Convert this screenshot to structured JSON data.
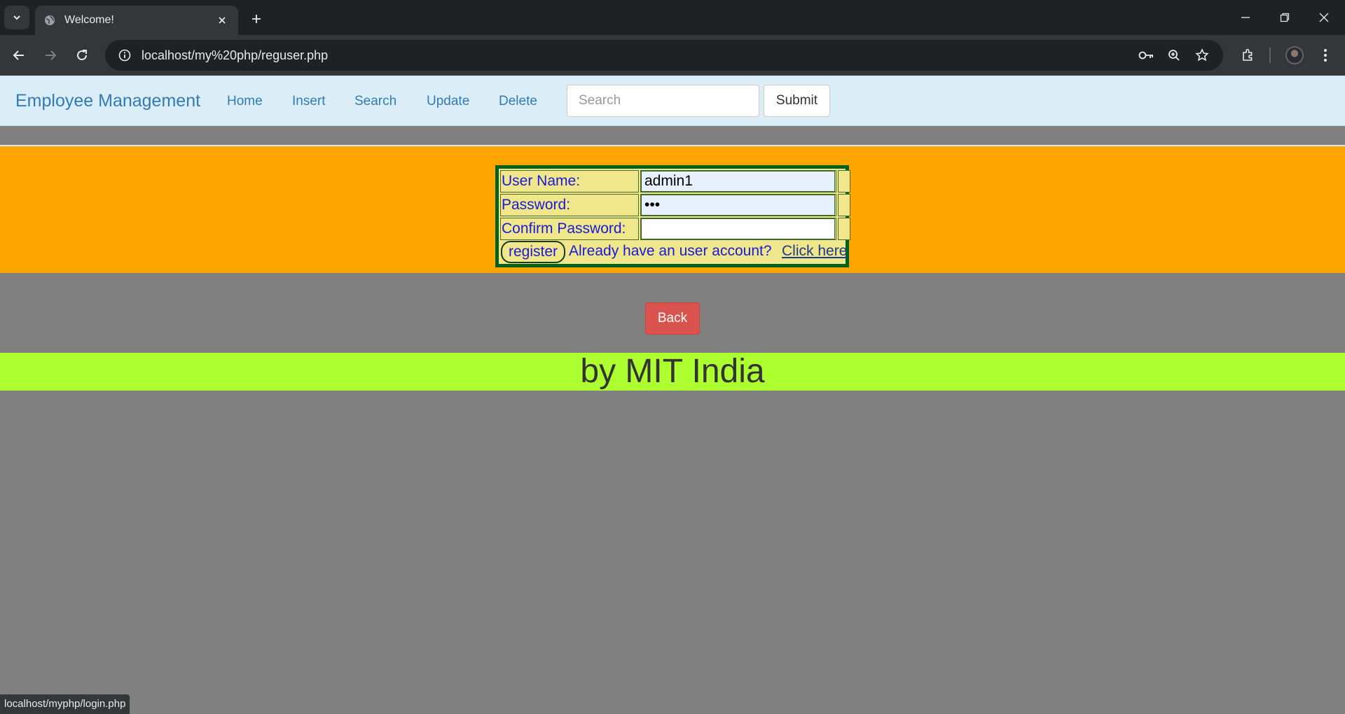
{
  "browser": {
    "tab_title": "Welcome!",
    "url": "localhost/my%20php/reguser.php",
    "status_url": "localhost/myphp/login.php"
  },
  "navbar": {
    "brand": "Employee Management",
    "links": [
      "Home",
      "Insert",
      "Search",
      "Update",
      "Delete"
    ],
    "search_placeholder": "Search",
    "submit_label": "Submit"
  },
  "form": {
    "username_label": "User Name:",
    "username_value": "admin1",
    "password_label": "Password:",
    "password_value": "•••",
    "confirm_label": "Confirm Password:",
    "confirm_value": "",
    "register_label": "register",
    "already_text": "Already have an user account?",
    "click_here": "Click here"
  },
  "back_label": "Back",
  "footer_text": "by MIT India",
  "colors": {
    "orange_band": "#ffa500",
    "footer": "#adff2f",
    "back_button": "#d9534f",
    "table_fill": "#f0e68c",
    "table_border": "#00611c",
    "page_bg": "#808080",
    "navbar_bg": "#dbeef8",
    "link": "#337ab7"
  }
}
